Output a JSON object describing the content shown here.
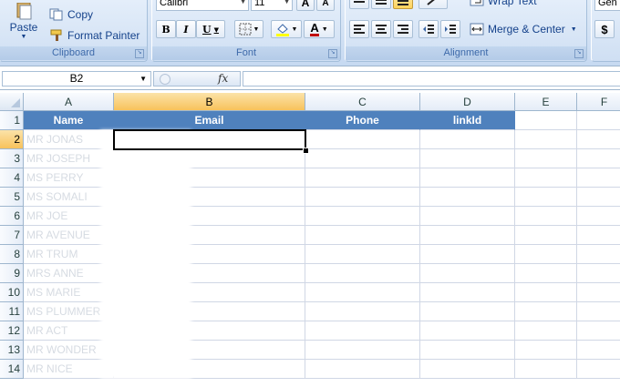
{
  "ribbon": {
    "clipboard": {
      "label": "Clipboard",
      "paste": "Paste",
      "copy": "Copy",
      "format_painter": "Format Painter"
    },
    "font": {
      "label": "Font",
      "font_name": "Calibri",
      "font_size": "11",
      "bold": "B",
      "italic": "I",
      "underline": "U",
      "grow": "A",
      "shrink": "A",
      "font_color": "A"
    },
    "alignment": {
      "label": "Alignment",
      "wrap_text": "Wrap Text",
      "merge_center": "Merge & Center"
    },
    "number": {
      "format_value": "Gen",
      "currency": "$"
    }
  },
  "formula_bar": {
    "name_box": "B2",
    "fx": "fx",
    "content": ""
  },
  "sheet": {
    "columns": [
      "A",
      "B",
      "C",
      "D",
      "E",
      "F"
    ],
    "active_column": "B",
    "active_row": "2",
    "rows": [
      "1",
      "2",
      "3",
      "4",
      "5",
      "6",
      "7",
      "8",
      "9",
      "10",
      "11",
      "12",
      "13",
      "14"
    ],
    "header_row": [
      "Name",
      "Email",
      "Phone",
      "linkId"
    ],
    "names": [
      "MR JONAS",
      "MR JOSEPH",
      "MS PERRY",
      "MS SOMALI",
      "MR JOE",
      "MR AVENUE",
      "MR TRUM",
      "MRS ANNE",
      "MS MARIE",
      "MS PLUMMER",
      "MR ACT",
      "MR WONDER",
      "MR NICE"
    ]
  },
  "colors": {
    "header_fill": "#4f81bd",
    "active_header": "#f8c25b",
    "gridline": "#d0d7e5",
    "ribbon_bg": "#c6d9f1"
  }
}
